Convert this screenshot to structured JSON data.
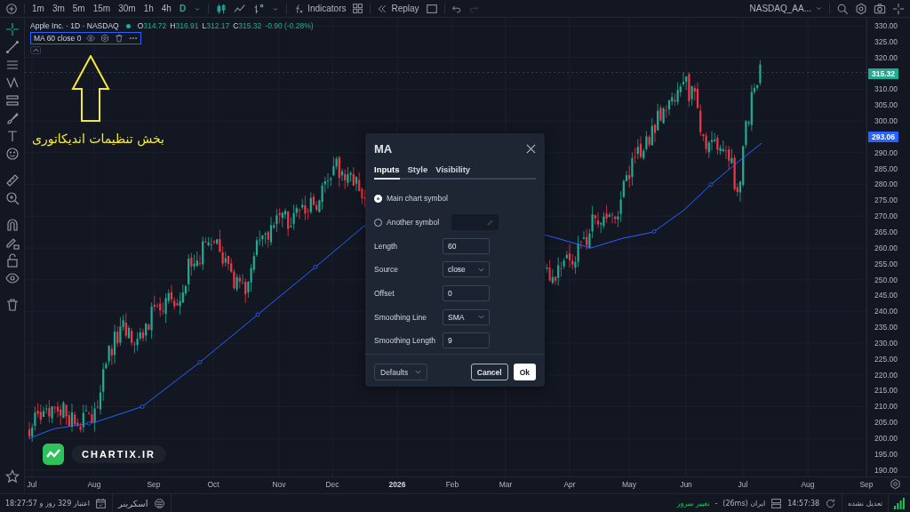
{
  "toolbar": {
    "intervals": [
      {
        "label": "1m",
        "selected": false
      },
      {
        "label": "3m",
        "selected": false
      },
      {
        "label": "5m",
        "selected": false
      },
      {
        "label": "15m",
        "selected": false
      },
      {
        "label": "30m",
        "selected": false
      },
      {
        "label": "1h",
        "selected": false
      },
      {
        "label": "4h",
        "selected": false
      },
      {
        "label": "D",
        "selected": true
      }
    ],
    "indicators_button": "Indicators",
    "replay_button": "Replay",
    "symbol": "NASDAQ_AA..."
  },
  "legend": {
    "symbol": "Apple Inc. · 1D · NASDAQ",
    "ohlc": [
      {
        "label": "O",
        "value": "314.72"
      },
      {
        "label": "H",
        "value": "316.91"
      },
      {
        "label": "L",
        "value": "312.17"
      },
      {
        "label": "C",
        "value": "315.32"
      }
    ],
    "change": "-0.90 (-0.28%)"
  },
  "indicator": {
    "label": "MA 60 close 0"
  },
  "annotation": {
    "text": "بخش تنظیمات اندیکاتوری"
  },
  "logo": {
    "text": "CHARTIX.IR"
  },
  "price_axis": {
    "labels": [
      {
        "kind": "tick",
        "label": "330.00"
      },
      {
        "kind": "tick",
        "label": "325.00"
      },
      {
        "kind": "tick",
        "label": "320.00"
      },
      {
        "kind": "badge",
        "label": "315.32",
        "color": "#22ab94"
      },
      {
        "kind": "tick",
        "label": "310.00"
      },
      {
        "kind": "tick",
        "label": "305.00"
      },
      {
        "kind": "tick",
        "label": "300.00"
      },
      {
        "kind": "badge",
        "label": "293.06",
        "color": "#2962ff"
      },
      {
        "kind": "tick",
        "label": "290.00"
      },
      {
        "kind": "tick",
        "label": "285.00"
      },
      {
        "kind": "tick",
        "label": "280.00"
      },
      {
        "kind": "tick",
        "label": "275.00"
      },
      {
        "kind": "tick",
        "label": "270.00"
      },
      {
        "kind": "tick",
        "label": "265.00"
      },
      {
        "kind": "tick",
        "label": "260.00"
      },
      {
        "kind": "tick",
        "label": "255.00"
      },
      {
        "kind": "tick",
        "label": "250.00"
      },
      {
        "kind": "tick",
        "label": "245.00"
      },
      {
        "kind": "tick",
        "label": "240.00"
      },
      {
        "kind": "tick",
        "label": "235.00"
      },
      {
        "kind": "tick",
        "label": "230.00"
      },
      {
        "kind": "tick",
        "label": "225.00"
      },
      {
        "kind": "tick",
        "label": "220.00"
      },
      {
        "kind": "tick",
        "label": "215.00"
      },
      {
        "kind": "tick",
        "label": "210.00"
      },
      {
        "kind": "tick",
        "label": "205.00"
      },
      {
        "kind": "tick",
        "label": "200.00"
      },
      {
        "kind": "tick",
        "label": "195.00"
      },
      {
        "kind": "tick",
        "label": "190.00"
      }
    ]
  },
  "time_axis": {
    "labels": [
      "Jul",
      "Aug",
      "Sep",
      "Oct",
      "Nov",
      "Dec",
      "2026",
      "Feb",
      "Mar",
      "Apr",
      "May",
      "Jun",
      "Jul",
      "Aug",
      "Sep"
    ]
  },
  "dialog": {
    "title": "MA",
    "tabs": [
      {
        "label": "Inputs",
        "selected": true
      },
      {
        "label": "Style",
        "selected": false
      },
      {
        "label": "Visibility",
        "selected": false
      }
    ],
    "symbol_options": [
      {
        "label": "Main chart symbol",
        "selected": true
      },
      {
        "label": "Another symbol",
        "selected": false
      }
    ],
    "fields": [
      {
        "label": "Length",
        "kind": "input",
        "value": "60"
      },
      {
        "label": "Source",
        "kind": "select",
        "value": "close"
      },
      {
        "label": "Offset",
        "kind": "input",
        "value": "0"
      },
      {
        "label": "Smoothing Line",
        "kind": "select",
        "value": "SMA"
      },
      {
        "label": "Smoothing Length",
        "kind": "input",
        "value": "9"
      }
    ],
    "defaults_button": "Defaults",
    "cancel_button": "Cancel",
    "ok_button": "Ok"
  },
  "status_bar": {
    "credit": "اعتبار 329 روز و 18:27:57",
    "screener": "اسکرینر",
    "change_server": "تغییر سرور",
    "separator": "-",
    "server": "ایران (26ms)",
    "time": "14:57:38",
    "adjustment": "تعدیل نشده"
  }
}
